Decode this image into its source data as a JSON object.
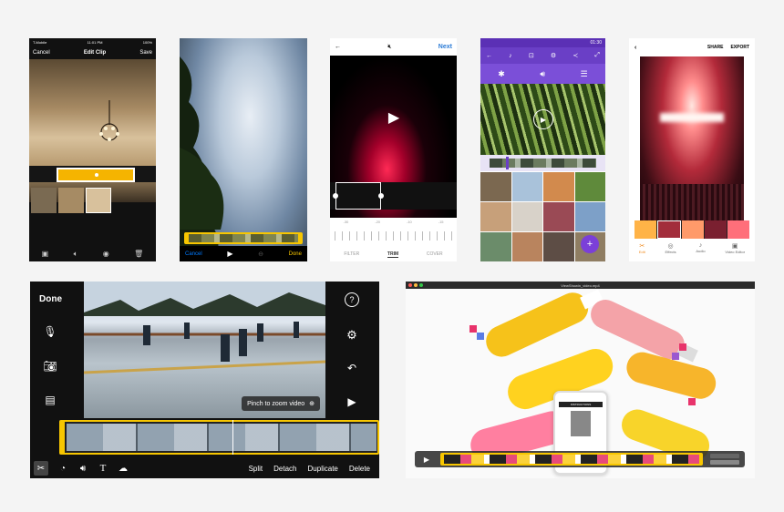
{
  "panel1": {
    "carrier": "T-Mobile",
    "time": "11:01 PM",
    "battery": "100%",
    "cancel": "Cancel",
    "title": "Edit Clip",
    "save": "Save"
  },
  "panel2": {
    "cancel": "Cancel",
    "done": "Done"
  },
  "panel3": {
    "next": "Next",
    "ticks": [
      "-30",
      "-20",
      "-10",
      "-15"
    ],
    "tabs": [
      "FILTER",
      "TRIM",
      "COVER"
    ]
  },
  "panel4": {
    "time": "01:30",
    "fab": "+"
  },
  "panel5": {
    "share": "SHARE",
    "export": "EXPORT",
    "tabs": [
      "Edit",
      "Effects",
      "Audio",
      "Video Editor"
    ]
  },
  "panel6": {
    "done": "Done",
    "pinch": "Pinch to zoom video",
    "actions": [
      "Split",
      "Detach",
      "Duplicate",
      "Delete"
    ]
  },
  "panel7": {
    "window_title": "ViewShowin_video.mp4",
    "phone_title": "INSTRUCTIONS"
  },
  "colors": {
    "ios_blue": "#007aff",
    "trim_yellow": "#f7c600",
    "android_purple": "#6a3fc6",
    "orange_accent": "#f08a1c"
  }
}
